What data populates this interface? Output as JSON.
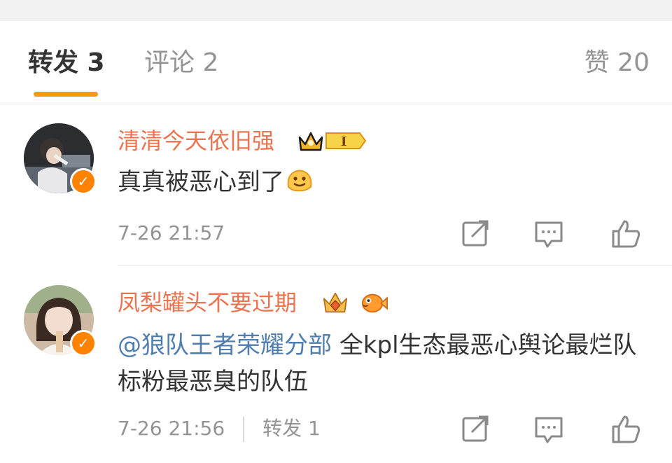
{
  "tabs": {
    "repost": "转发 3",
    "comment": "评论 2",
    "like": "赞 20"
  },
  "comments": [
    {
      "username": "清清今天依旧强",
      "badge_text": "I",
      "content": "真真被恶心到了",
      "time": "7-26 21:57"
    },
    {
      "username": "凤梨罐头不要过期",
      "mention": "@狼队王者荣耀分部",
      "content": "全kpl生态最恶心舆论最烂队标粉最恶臭的队伍",
      "time": "7-26 21:56",
      "repost_label": "转发 1"
    }
  ],
  "icons": {
    "verified": "verified-icon",
    "share": "share-icon",
    "comment": "comment-icon",
    "like": "thumbs-up-icon",
    "emoji": "smile-emoji-icon",
    "crown": "crown-icon",
    "fish": "fish-icon"
  },
  "colors": {
    "accent": "#f39c12",
    "username": "#eb7350",
    "mention": "#507daf",
    "verified": "#ff8200"
  }
}
